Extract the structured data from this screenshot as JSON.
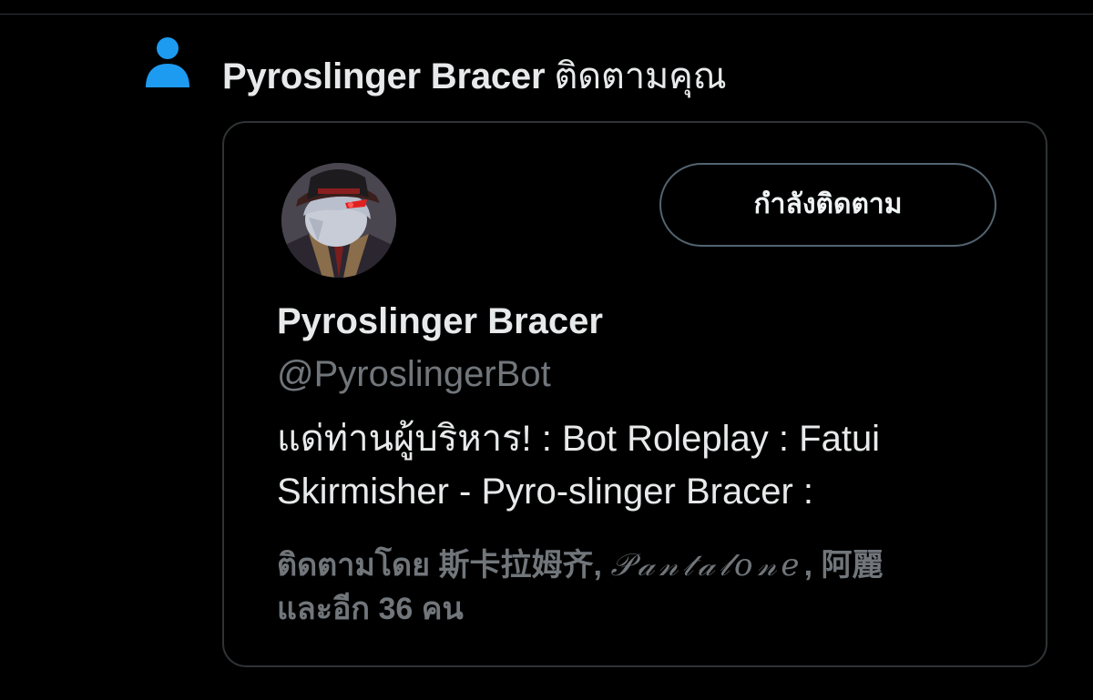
{
  "notification": {
    "icon": "person-icon",
    "icon_color": "#1d9bf0",
    "user_name": "Pyroslinger Bracer",
    "action_text": "ติดตามคุณ"
  },
  "card": {
    "follow_button_label": "กำลังติดตาม",
    "display_name": "Pyroslinger Bracer",
    "handle": "@PyroslingerBot",
    "bio_line_1": "แด่ท่านผู้บริหาร! : Bot Roleplay : Fatui",
    "bio_line_2": "Skirmisher - Pyro-slinger Bracer :",
    "followed_by": {
      "prefix": "ติดตามโดย",
      "name_1": "斯卡拉姆齐",
      "name_2": "𝒫𝒶𝓃𝓉𝒶𝓁𝑜𝓃𝑒",
      "name_3": "阿麗",
      "suffix": "และอีก 36 คน"
    }
  },
  "colors": {
    "background": "#000000",
    "primary_text": "#e7e9ea",
    "secondary_text": "#71767b",
    "border": "#2f3336",
    "accent": "#1d9bf0"
  }
}
